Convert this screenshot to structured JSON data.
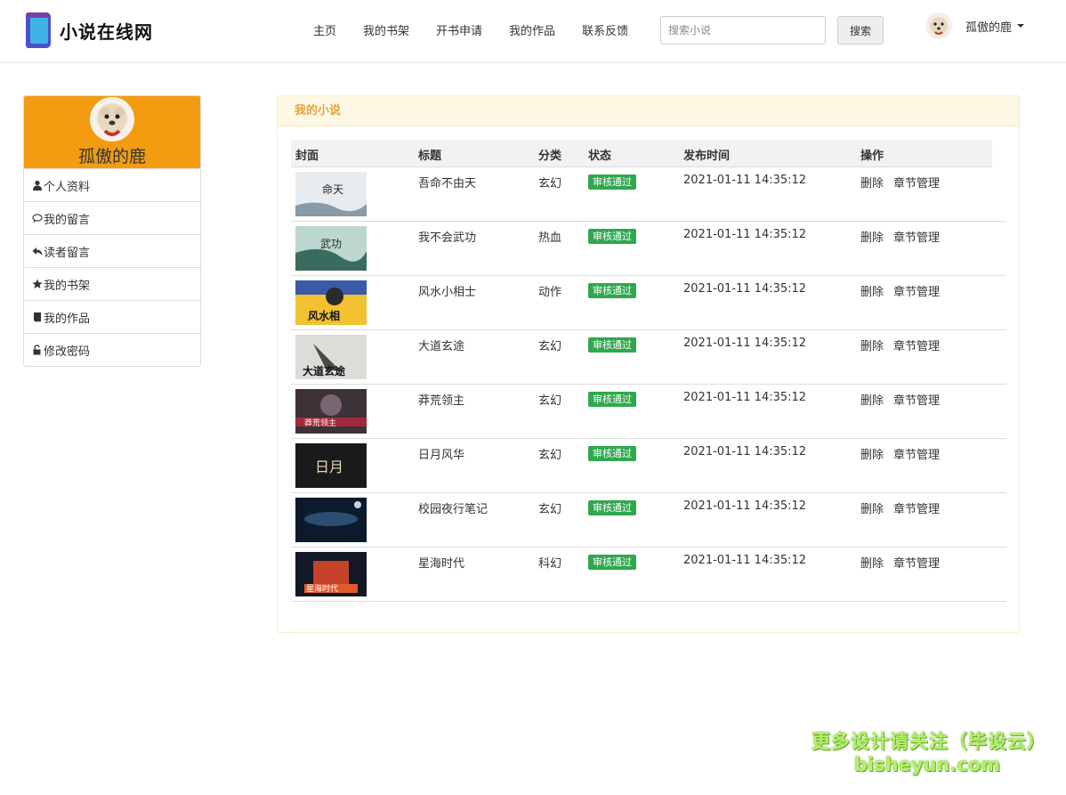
{
  "header": {
    "brand": "小说在线网",
    "nav": [
      "主页",
      "我的书架",
      "开书申请",
      "我的作品",
      "联系反馈"
    ],
    "search_placeholder": "搜索小说",
    "search_button": "搜索",
    "user_name": "孤傲的鹿"
  },
  "sidebar": {
    "user_name": "孤傲的鹿",
    "items": [
      "个人资料",
      "我的留言",
      "读者留言",
      "我的书架",
      "我的作品",
      "修改密码"
    ]
  },
  "panel": {
    "title": "我的小说",
    "columns": [
      "封面",
      "标题",
      "分类",
      "状态",
      "发布时间",
      "操作"
    ],
    "rows": [
      {
        "title": "吾命不由天",
        "category": "玄幻",
        "status": "审核通过",
        "time": "2021-01-11 14:35:12",
        "delete": "删除",
        "manage": "章节管理"
      },
      {
        "title": "我不会武功",
        "category": "热血",
        "status": "审核通过",
        "time": "2021-01-11 14:35:12",
        "delete": "删除",
        "manage": "章节管理"
      },
      {
        "title": "风水小相士",
        "category": "动作",
        "status": "审核通过",
        "time": "2021-01-11 14:35:12",
        "delete": "删除",
        "manage": "章节管理"
      },
      {
        "title": "大道玄途",
        "category": "玄幻",
        "status": "审核通过",
        "time": "2021-01-11 14:35:12",
        "delete": "删除",
        "manage": "章节管理"
      },
      {
        "title": "莽荒领主",
        "category": "玄幻",
        "status": "审核通过",
        "time": "2021-01-11 14:35:12",
        "delete": "删除",
        "manage": "章节管理"
      },
      {
        "title": "日月风华",
        "category": "玄幻",
        "status": "审核通过",
        "time": "2021-01-11 14:35:12",
        "delete": "删除",
        "manage": "章节管理"
      },
      {
        "title": "校园夜行笔记",
        "category": "玄幻",
        "status": "审核通过",
        "time": "2021-01-11 14:35:12",
        "delete": "删除",
        "manage": "章节管理"
      },
      {
        "title": "星海时代",
        "category": "科幻",
        "status": "审核通过",
        "time": "2021-01-11 14:35:12",
        "delete": "删除",
        "manage": "章节管理"
      }
    ]
  },
  "watermark": {
    "line1": "更多设计请关注（毕设云）",
    "line2": "bisheyun.com"
  }
}
